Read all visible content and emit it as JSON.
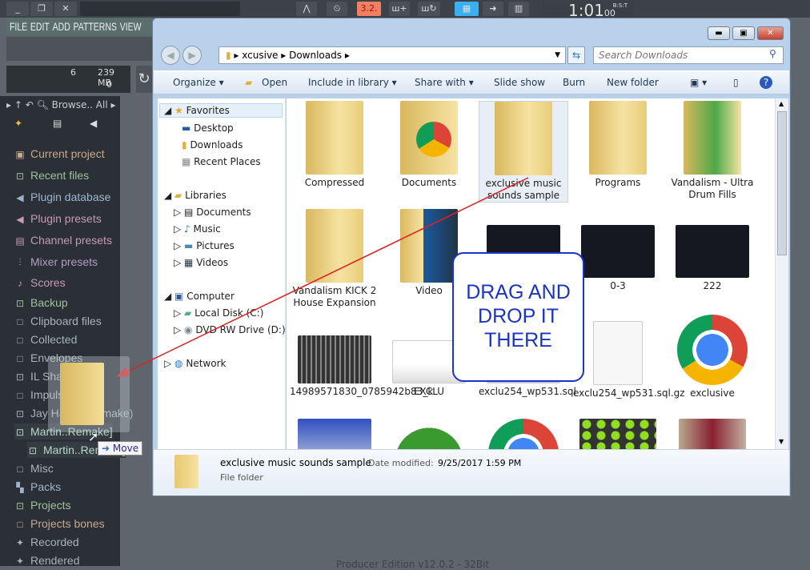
{
  "fl": {
    "menu": [
      "FILE",
      "EDIT",
      "ADD",
      "PATTERNS",
      "VIEW"
    ],
    "tempo_display": "3.2.",
    "time_display": "1:01",
    "time_sub": "00",
    "time_unit": "B:S:T",
    "meter_value": "6",
    "memory": "239 MB",
    "cpu_value": "0",
    "browser_header": {
      "label": "Browse..",
      "filter": "All"
    },
    "browser_items": [
      {
        "label": "Current project",
        "color": "#c9a88e",
        "icon": "project-icon"
      },
      {
        "label": "Recent files",
        "color": "#9fc39a",
        "icon": "folder-plus-icon"
      },
      {
        "label": "Plugin database",
        "color": "#9db4cf",
        "icon": "plug-icon"
      },
      {
        "label": "Plugin presets",
        "color": "#c89ab8",
        "icon": "plug-icon"
      },
      {
        "label": "Channel presets",
        "color": "#c89ab8",
        "icon": "channel-icon"
      },
      {
        "label": "Mixer presets",
        "color": "#b49ac8",
        "icon": "mixer-icon"
      },
      {
        "label": "Scores",
        "color": "#c89ab8",
        "icon": "note-icon"
      },
      {
        "label": "Backup",
        "color": "#9fc39a",
        "icon": "folder-plus-icon"
      },
      {
        "label": "Clipboard files",
        "color": "#a8b4b8",
        "icon": "folder-icon"
      },
      {
        "label": "Collected",
        "color": "#a8b4b8",
        "icon": "folder-icon"
      },
      {
        "label": "Envelopes",
        "color": "#a8b4b8",
        "icon": "folder-icon"
      },
      {
        "label": "IL Shared data",
        "color": "#a8b4b8",
        "icon": "folder-plus-icon"
      },
      {
        "label": "Impulses",
        "color": "#a8b4b8",
        "icon": "folder-icon"
      },
      {
        "label": "Jay Hardy (Remake)",
        "color": "#a8b4b8",
        "icon": "folder-plus-icon"
      },
      {
        "label": "Martin..Remake]",
        "color": "#b8d8c8",
        "icon": "folder-plus-icon"
      },
      {
        "label": "Martin..Remake]",
        "color": "#b8d8c8",
        "icon": "folder-plus-icon"
      },
      {
        "label": "Misc",
        "color": "#a8b4b8",
        "icon": "folder-icon"
      },
      {
        "label": "Packs",
        "color": "#9db4cf",
        "icon": "packs-icon"
      },
      {
        "label": "Projects",
        "color": "#9fc39a",
        "icon": "folder-plus-icon"
      },
      {
        "label": "Projects bones",
        "color": "#c9a88e",
        "icon": "folder-icon"
      },
      {
        "label": "Recorded",
        "color": "#a8b4b8",
        "icon": "wave-icon"
      },
      {
        "label": "Rendered",
        "color": "#a8b4b8",
        "icon": "wave-icon"
      }
    ],
    "status_text": "Producer Edition v12.0.2 - 32Bit"
  },
  "explorer": {
    "breadcrumb": [
      "xcusive",
      "Downloads"
    ],
    "search_placeholder": "Search Downloads",
    "toolbar": [
      "Organize ▾",
      "Open",
      "Include in library ▾",
      "Share with ▾",
      "Slide show",
      "Burn",
      "New folder"
    ],
    "nav": {
      "favorites": {
        "label": "Favorites",
        "items": [
          "Desktop",
          "Downloads",
          "Recent Places"
        ]
      },
      "libraries": {
        "label": "Libraries",
        "items": [
          "Documents",
          "Music",
          "Pictures",
          "Videos"
        ]
      },
      "computer": {
        "label": "Computer",
        "items": [
          "Local Disk (C:)",
          "DVD RW Drive (D:) p"
        ]
      },
      "network": {
        "label": "Network"
      }
    },
    "files": [
      {
        "label": "Compressed",
        "type": "folder"
      },
      {
        "label": "Documents",
        "type": "folder-chrome"
      },
      {
        "label": "exclusive music sounds sample",
        "type": "folder",
        "selected": true
      },
      {
        "label": "Programs",
        "type": "folder"
      },
      {
        "label": "Vandalism - Ultra Drum Fills",
        "type": "folder-green"
      },
      {
        "label": "Vandalism KICK 2 House Expansion",
        "type": "folder"
      },
      {
        "label": "Video",
        "type": "folder-video"
      },
      {
        "label": "",
        "type": "image-dark"
      },
      {
        "label": "0-3",
        "type": "image-dark"
      },
      {
        "label": "222",
        "type": "image-dark"
      },
      {
        "label": "14989571830_0785942b83_k",
        "type": "image-mixer"
      },
      {
        "label": "EXCLU",
        "type": "image-logo"
      },
      {
        "label": "exclu254_wp531.sql",
        "type": "image-blank"
      },
      {
        "label": "exclu254_wp531.sql.gz",
        "type": "file"
      },
      {
        "label": "exclusive",
        "type": "chrome"
      },
      {
        "label": "",
        "type": "image-xclusive"
      },
      {
        "label": "",
        "type": "image-green"
      },
      {
        "label": "",
        "type": "chrome"
      },
      {
        "label": "",
        "type": "image-dots"
      },
      {
        "label": "",
        "type": "image-photo"
      }
    ],
    "details": {
      "name": "exclusive music sounds sample",
      "modified_label": "Date modified:",
      "modified": "9/25/2017 1:59 PM",
      "type": "File folder"
    }
  },
  "annotation": {
    "callout": [
      "DRAG AND",
      "DROP IT",
      "THERE"
    ],
    "arrow_color": "#e02020"
  },
  "drag": {
    "tooltip": "Move"
  }
}
